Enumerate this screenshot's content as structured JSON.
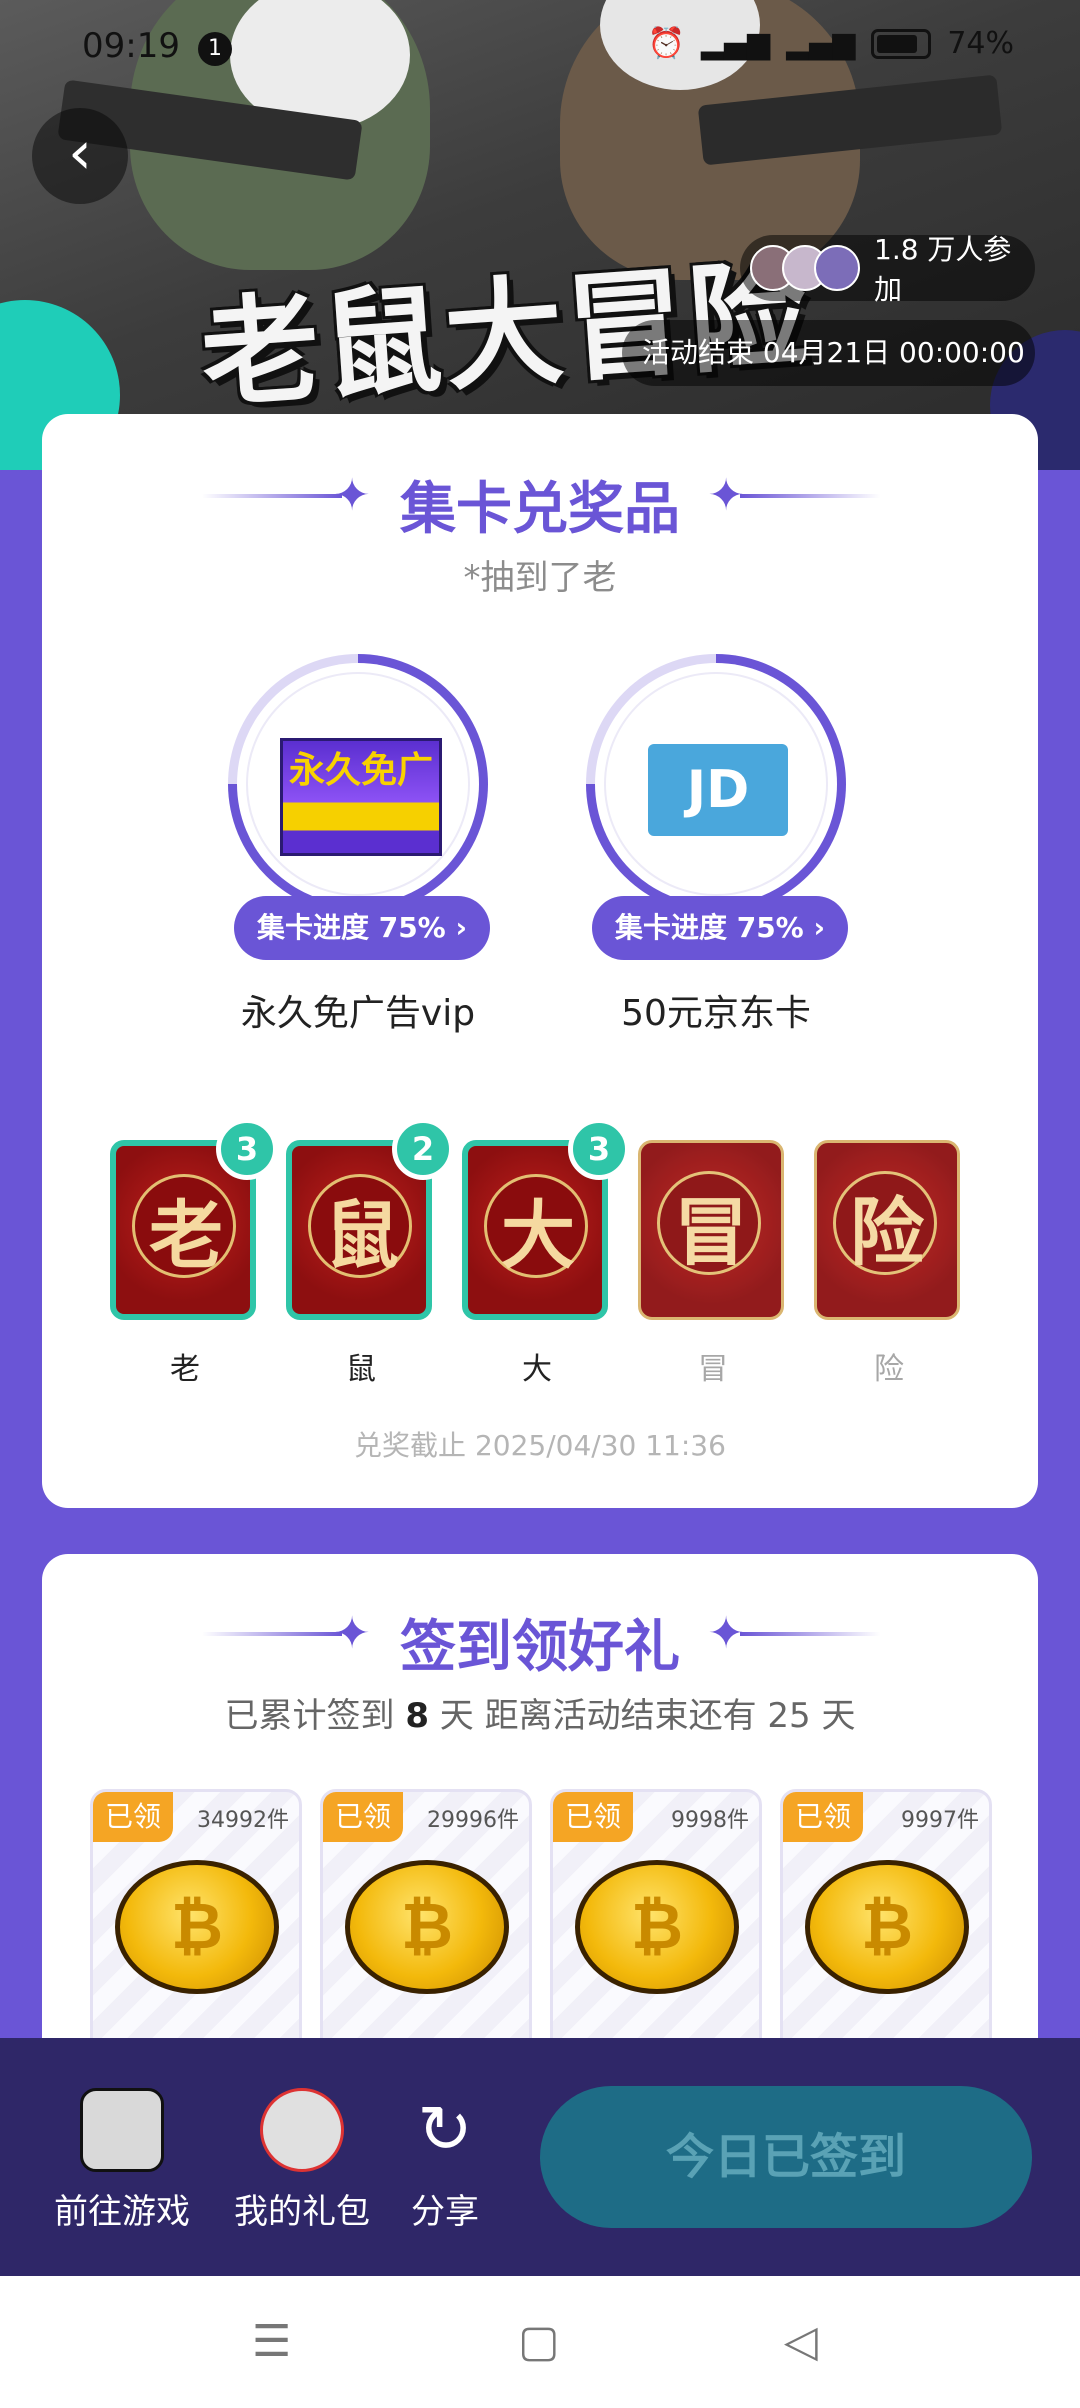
{
  "status_bar": {
    "time": "09:19",
    "notification_count": "1",
    "battery": "74%"
  },
  "banner": {
    "title": "老鼠大冒险",
    "participants": "1.8 万人参加",
    "end_time": "活动结束 04月21日 00:00:00"
  },
  "card_section": {
    "title": "集卡兑奖品",
    "subtitle": "*抽到了老",
    "prizes": [
      {
        "name": "永久免广告vip",
        "progress": "集卡进度 75% ›",
        "progress_value": 75,
        "image_text": "永久免广"
      },
      {
        "name": "50元京东卡",
        "progress": "集卡进度 75% ›",
        "progress_value": 75,
        "image_text": "JD"
      }
    ],
    "cards": [
      {
        "char": "老",
        "label": "老",
        "count": "3",
        "owned": true
      },
      {
        "char": "鼠",
        "label": "鼠",
        "count": "2",
        "owned": true
      },
      {
        "char": "大",
        "label": "大",
        "count": "3",
        "owned": true
      },
      {
        "char": "冒",
        "label": "冒",
        "count": "",
        "owned": false
      },
      {
        "char": "险",
        "label": "险",
        "count": "",
        "owned": false
      }
    ],
    "deadline": "兑奖截止 2025/04/30 11:36"
  },
  "signin_section": {
    "title": "签到领好礼",
    "info_prefix": "已累计签到",
    "days": "8",
    "info_mid": "天  距离活动结束还有 25 天",
    "tiles": [
      {
        "status": "已领",
        "qty": "34992件"
      },
      {
        "status": "已领",
        "qty": "29996件"
      },
      {
        "status": "已领",
        "qty": "9998件"
      },
      {
        "status": "已领",
        "qty": "9997件"
      }
    ]
  },
  "action_bar": {
    "go_game": "前往游戏",
    "my_gift": "我的礼包",
    "share": "分享",
    "signed": "今日已签到"
  },
  "colors": {
    "accent": "#6a55d6",
    "teal": "#2fc5a8",
    "action_bar": "#2f2768",
    "signed_button": "#1e6c86"
  }
}
